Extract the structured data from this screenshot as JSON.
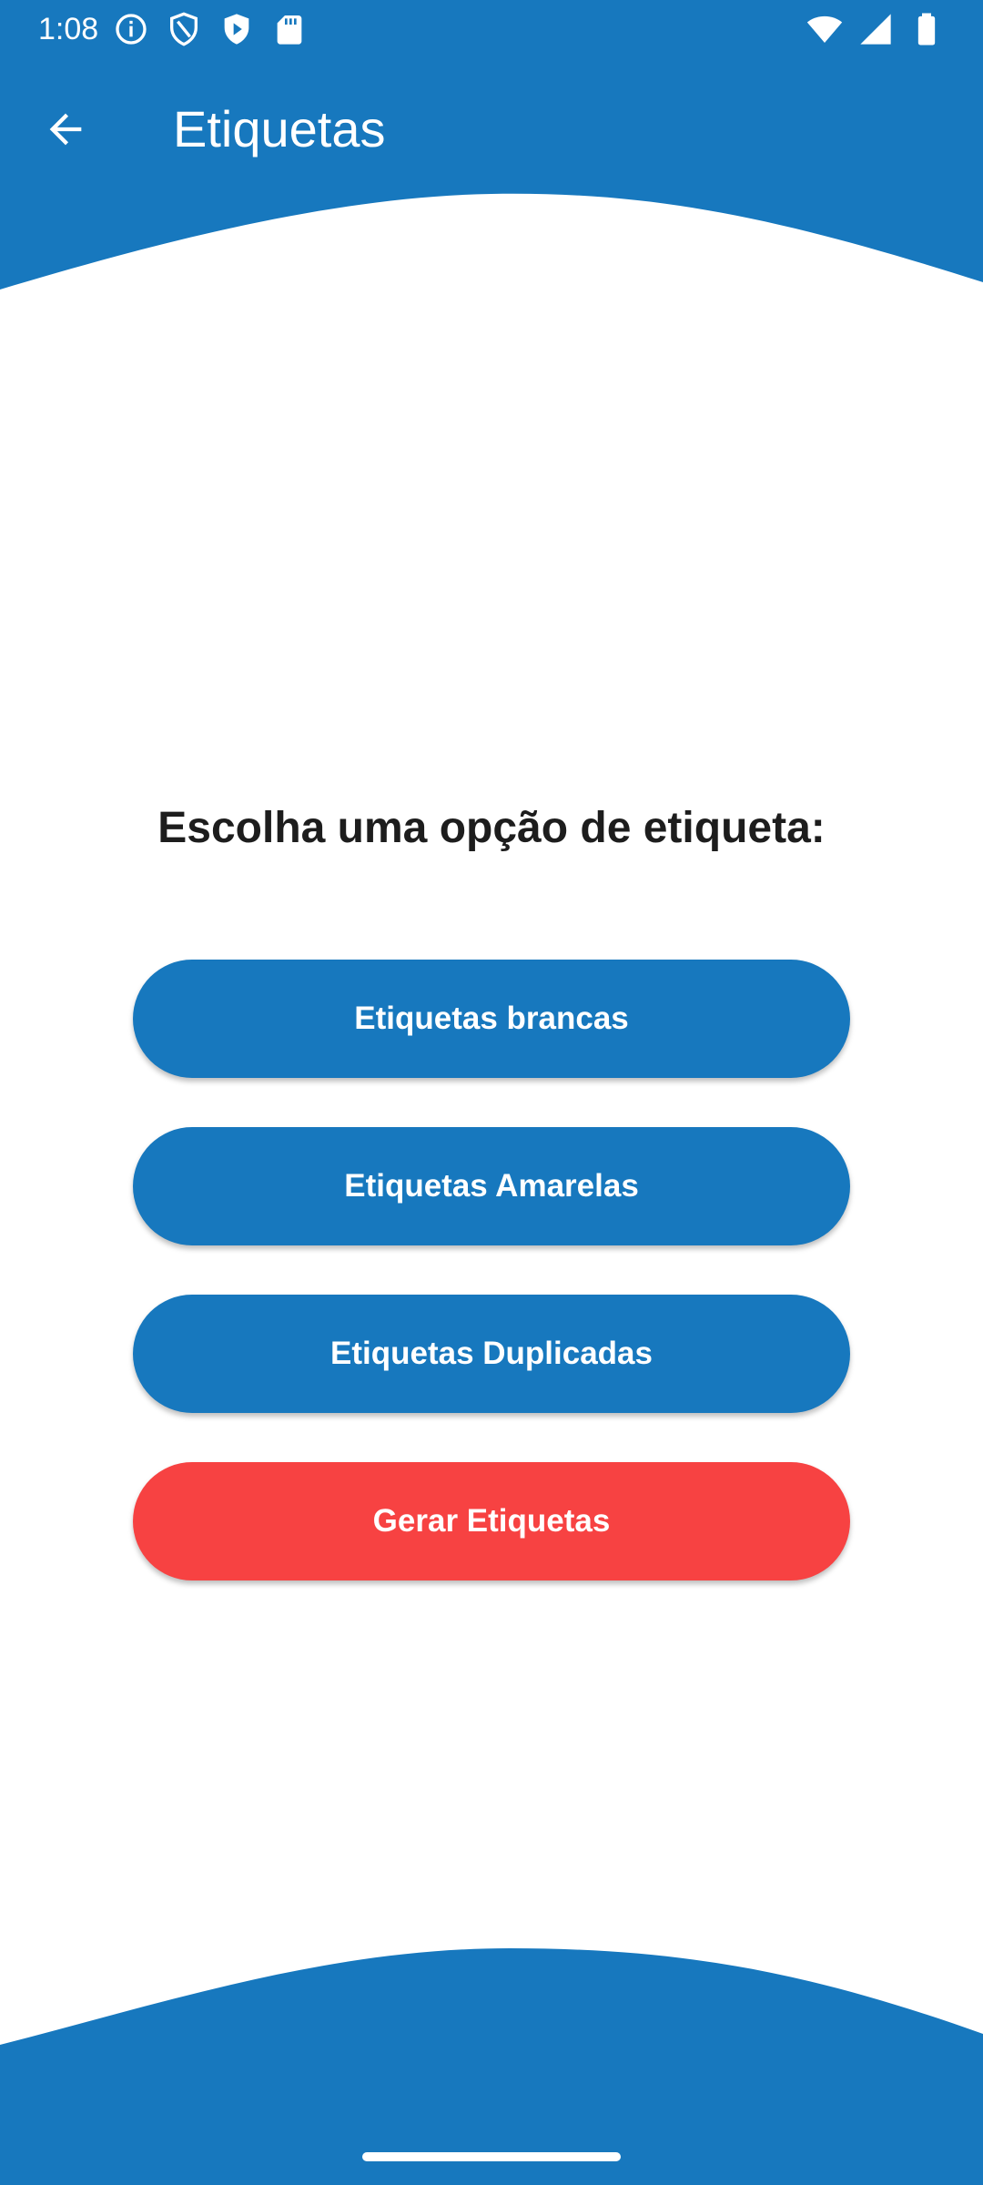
{
  "status_bar": {
    "time": "1:08",
    "left_icons": [
      "info-icon",
      "shield-outline-icon",
      "play-shield-icon",
      "sd-card-icon"
    ],
    "right_icons": [
      "wifi-icon",
      "signal-icon",
      "battery-icon"
    ]
  },
  "app_bar": {
    "title": "Etiquetas",
    "back_icon": "arrow-back-icon"
  },
  "main": {
    "heading": "Escolha uma opção de etiqueta:",
    "buttons": [
      {
        "label": "Etiquetas brancas"
      },
      {
        "label": "Etiquetas Amarelas"
      },
      {
        "label": "Etiquetas Duplicadas"
      },
      {
        "label": "Gerar Etiquetas"
      }
    ]
  },
  "colors": {
    "primary": "#1778be",
    "danger": "#f74242",
    "background": "#ffffff",
    "heading_text": "#1d1d1d"
  }
}
